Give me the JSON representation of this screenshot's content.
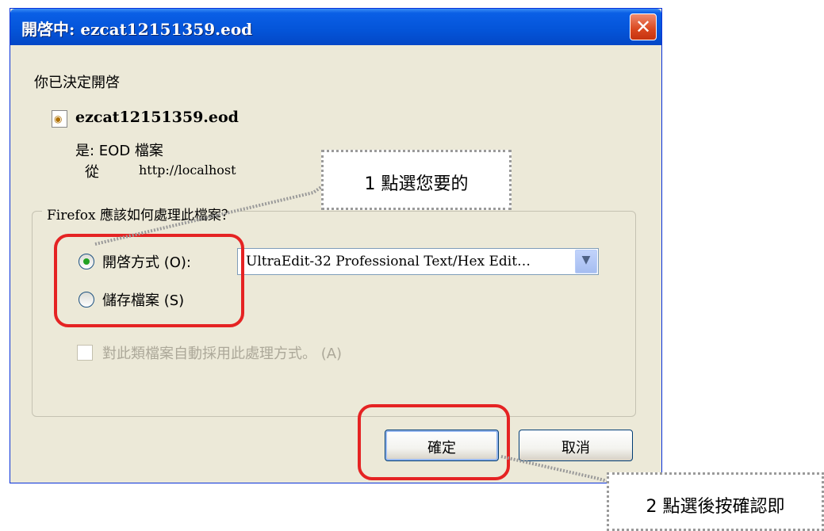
{
  "dialog": {
    "title": "開啓中: ezcat12151359.eod",
    "close_symbol": "✕",
    "heading": "你已決定開啓",
    "file_name": "ezcat12151359.eod",
    "file_icon": "document-icon",
    "type_line": "是: EOD 檔案",
    "from_label": "從",
    "from_url": "http://localhost",
    "group_label": "Firefox 應該如何處理此檔案？",
    "open_with_label": "開啓方式 (O):",
    "open_with_app": "UltraEdit-32 Professional Text/Hex Edit…",
    "save_label": "儲存檔案 (S)",
    "auto_label": "對此類檔案自動採用此處理方式。 (A)",
    "ok_label": "確定",
    "cancel_label": "取消",
    "selected_option": "open-with"
  },
  "annotations": {
    "callout1": "1 點選您要的",
    "callout2": "2 點選後按確認即",
    "highlight_color": "#e52323"
  }
}
